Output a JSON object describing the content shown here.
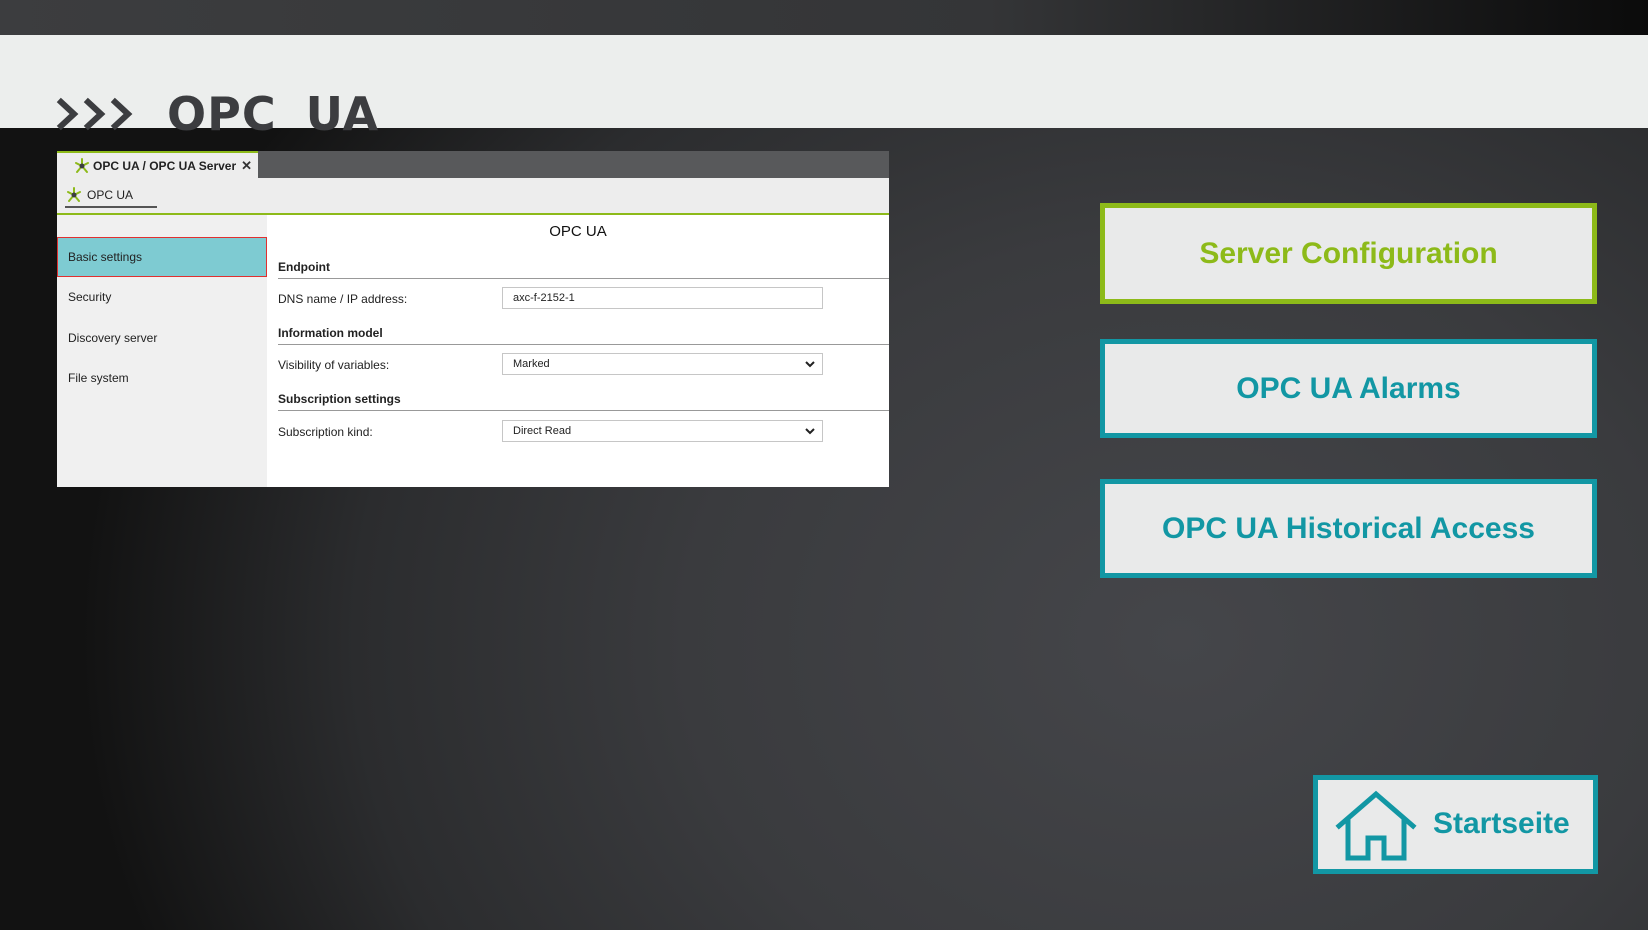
{
  "page": {
    "title": "OPC UA",
    "title_icon": "triple-chevron-right-icon"
  },
  "embedded_screenshot": {
    "tab": {
      "label": "OPC UA / OPC UA Server",
      "close": "✕",
      "icon": "opc-ua-star-icon"
    },
    "toolbar": {
      "item_label": "OPC UA",
      "icon": "opc-ua-star-icon"
    },
    "heading": "OPC UA",
    "sidebar": {
      "items": [
        {
          "label": "Basic settings",
          "active": true
        },
        {
          "label": "Security"
        },
        {
          "label": "Discovery server"
        },
        {
          "label": "File system"
        }
      ]
    },
    "sections": {
      "endpoint": {
        "title": "Endpoint",
        "dns_label": "DNS name / IP address:",
        "dns_value": "axc-f-2152-1"
      },
      "information_model": {
        "title": "Information model",
        "visibility_label": "Visibility of variables:",
        "visibility_value": "Marked"
      },
      "subscription": {
        "title": "Subscription settings",
        "kind_label": "Subscription kind:",
        "kind_value": "Direct Read"
      }
    }
  },
  "nav": {
    "server_configuration": "Server Configuration",
    "alarms": "OPC UA Alarms",
    "historical_access": "OPC UA Historical Access",
    "home": {
      "label": "Startseite",
      "icon": "house-icon"
    }
  },
  "colors": {
    "accent_green": "#8dba19",
    "accent_teal": "#1297a4",
    "selected_row": "#7ecbd2",
    "title_text": "#3c3d40"
  }
}
